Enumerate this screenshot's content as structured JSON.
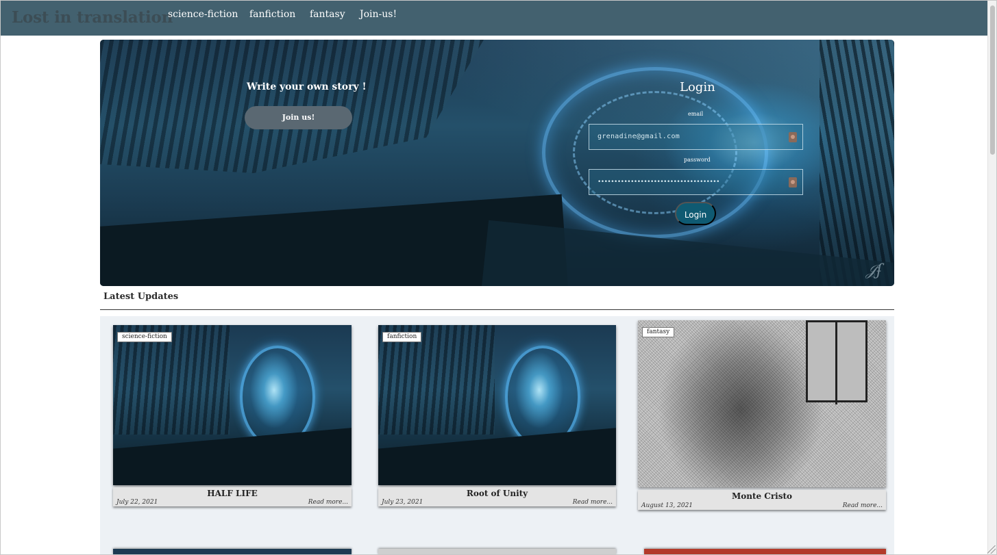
{
  "navbar": {
    "brand": "Lost in translation",
    "links": [
      "science-fiction",
      "fanfiction",
      "fantasy",
      "Join-us!"
    ]
  },
  "hero": {
    "cta_title": "Write your own story !",
    "join_button": "Join us!",
    "login": {
      "title": "Login",
      "email_label": "email",
      "email_value": "grenadine@gmail.com",
      "password_label": "password",
      "password_masked": "•••••••••••••••••••••••••••••••••••••",
      "submit_label": "Login"
    }
  },
  "latest": {
    "heading": "Latest Updates",
    "read_more": "Read more...",
    "cards": [
      {
        "tag": "science-fiction",
        "title": "HALF LIFE",
        "date": "July 22, 2021"
      },
      {
        "tag": "fanfiction",
        "title": "Root of Unity",
        "date": "July 23, 2021"
      },
      {
        "tag": "fantasy",
        "title": "Monte Cristo",
        "date": "August 13, 2021"
      }
    ]
  },
  "colors": {
    "navbar": "#43616f",
    "brand": "#3c4d55",
    "join_button": "#5a6872",
    "login_button": "#0f5a72",
    "cards_background": "#edf1f5"
  }
}
